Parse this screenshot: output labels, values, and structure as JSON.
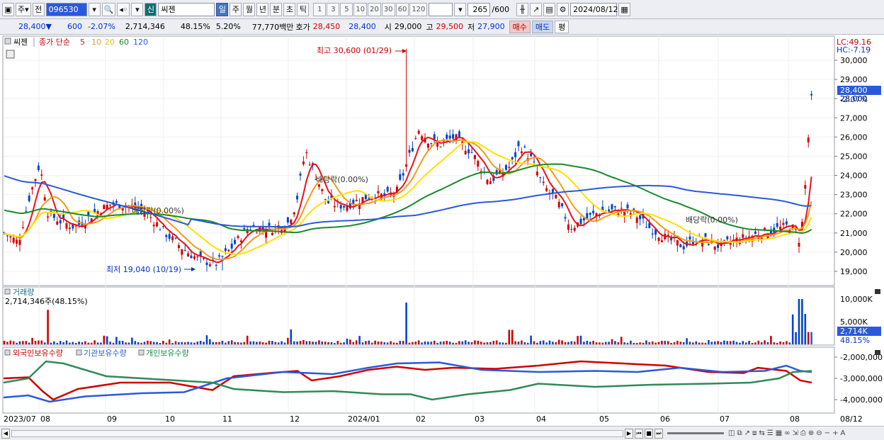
{
  "toolbar": {
    "market": "주",
    "prev_label": "전",
    "code": "096530",
    "sign_label": "신",
    "stock_name": "씨젠",
    "periods": [
      "일",
      "주",
      "월",
      "년",
      "분",
      "초",
      "틱"
    ],
    "nums": [
      "1",
      "3",
      "5",
      "10",
      "20",
      "30",
      "60",
      "120"
    ],
    "count": "265",
    "count_max": "/600",
    "date": "2024/08/12"
  },
  "quote": {
    "price": "28,400",
    "arrow": "▼",
    "change": "600",
    "rate": "-2.07%",
    "volume": "2,714,346",
    "vol_rate": "48.15%",
    "turnover": "5.20%",
    "amount": "77,770백만",
    "bid_label": "호가",
    "ask": "28,450",
    "bid": "28,400",
    "open_label": "시",
    "open": "29,000",
    "high_label": "고",
    "high": "29,500",
    "low_label": "저",
    "low": "27,900",
    "buy": "매수",
    "sell": "매도",
    "avg": "평"
  },
  "colors": {
    "up": "#d00000",
    "down": "#0044cc",
    "ma5": "#e8121a",
    "ma10": "#f39a1c",
    "ma20": "#ffe000",
    "ma60": "#1a8a2a",
    "ma120": "#2a5adb"
  },
  "price_panel": {
    "stock": "씨젠",
    "legend_title": "종가 단순",
    "ma_labels": [
      "5",
      "10",
      "20",
      "60",
      "120"
    ],
    "lc": "LC:49.16",
    "hc": "HC:-7.19",
    "ticks": [
      "30,000",
      "29,000",
      "28,000",
      "27,000",
      "26,000",
      "25,000",
      "24,000",
      "23,000",
      "22,000",
      "21,000",
      "20,000",
      "19,000"
    ],
    "tick_values": [
      30000,
      29000,
      28000,
      27000,
      26000,
      25000,
      24000,
      23000,
      22000,
      21000,
      20000,
      19000
    ],
    "current": "28,400",
    "current_rate": "-2.07%",
    "max_label": "최고 30,600 (01/29)",
    "min_label": "최저 19,040 (10/19)",
    "div_labels": [
      "배당락(0.00%)",
      "배당락(0.00%)",
      "배당락(0.00%)"
    ]
  },
  "volume_panel": {
    "title": "거래량",
    "value": "2,714,346주(48.15%)",
    "ticks": [
      "10,000K",
      "5,000K"
    ],
    "tick_values": [
      10000,
      5000
    ],
    "current": "2,714K",
    "current_rate": "48.15%"
  },
  "holding_panel": {
    "labels": [
      "외국인보유수량",
      "기관보유수량",
      "개인보유수량"
    ],
    "ticks": [
      "-2,000,000",
      "-3,000,000",
      "-4,000,000"
    ],
    "tick_values": [
      -2000000,
      -3000000,
      -4000000
    ]
  },
  "x_labels": [
    "2023/07",
    "08",
    "09",
    "10",
    "11",
    "12",
    "2024/01",
    "02",
    "03",
    "04",
    "05",
    "06",
    "07",
    "08",
    "08/12"
  ]
}
